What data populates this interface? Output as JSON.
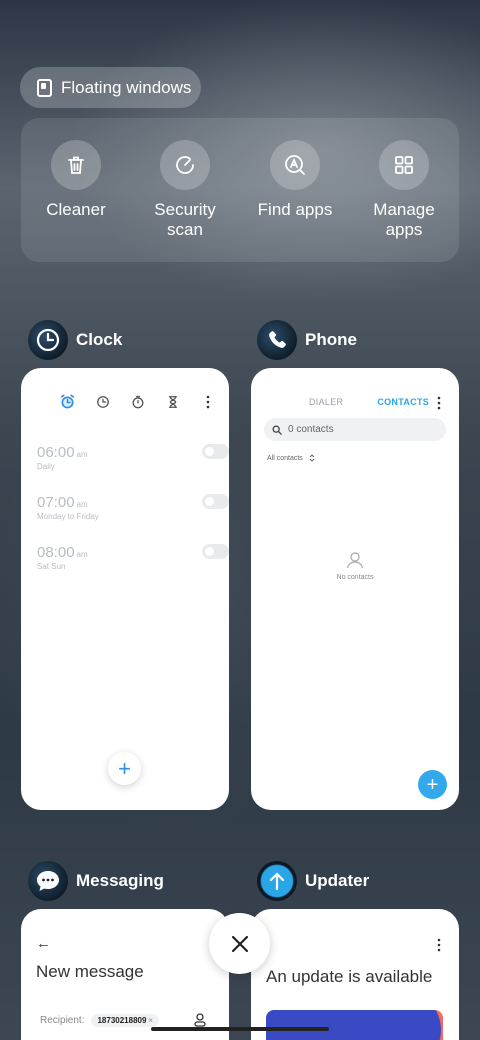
{
  "floating_windows": {
    "label": "Floating windows"
  },
  "quick_actions": [
    {
      "label": "Cleaner",
      "icon": "trash-icon"
    },
    {
      "label": "Security\nscan",
      "icon": "security-scan-icon"
    },
    {
      "label": "Find apps",
      "icon": "find-apps-icon"
    },
    {
      "label": "Manage\napps",
      "icon": "grid-icon"
    }
  ],
  "apps": {
    "clock": {
      "name": "Clock",
      "alarms": [
        {
          "time": "06:00",
          "ampm": "am",
          "repeat": "Daily"
        },
        {
          "time": "07:00",
          "ampm": "am",
          "repeat": "Monday to Friday"
        },
        {
          "time": "08:00",
          "ampm": "am",
          "repeat": "Sat Sun"
        }
      ],
      "fab_label": "+"
    },
    "phone": {
      "name": "Phone",
      "tabs": [
        "DIALER",
        "CONTACTS"
      ],
      "search_placeholder": "0 contacts",
      "filter_label": "All contacts",
      "empty_label": "No contacts",
      "fab_label": "+"
    },
    "messaging": {
      "name": "Messaging",
      "back_arrow": "←",
      "title": "New message",
      "recipient_label": "Recipient:",
      "recipient_chip": "18730218809",
      "chip_remove": "×"
    },
    "updater": {
      "name": "Updater",
      "title": "An update is available"
    }
  },
  "colors": {
    "accent_blue": "#2b8fe8",
    "contacts_tab": "#2aa6e6",
    "fab_blue": "#33a9ec"
  }
}
